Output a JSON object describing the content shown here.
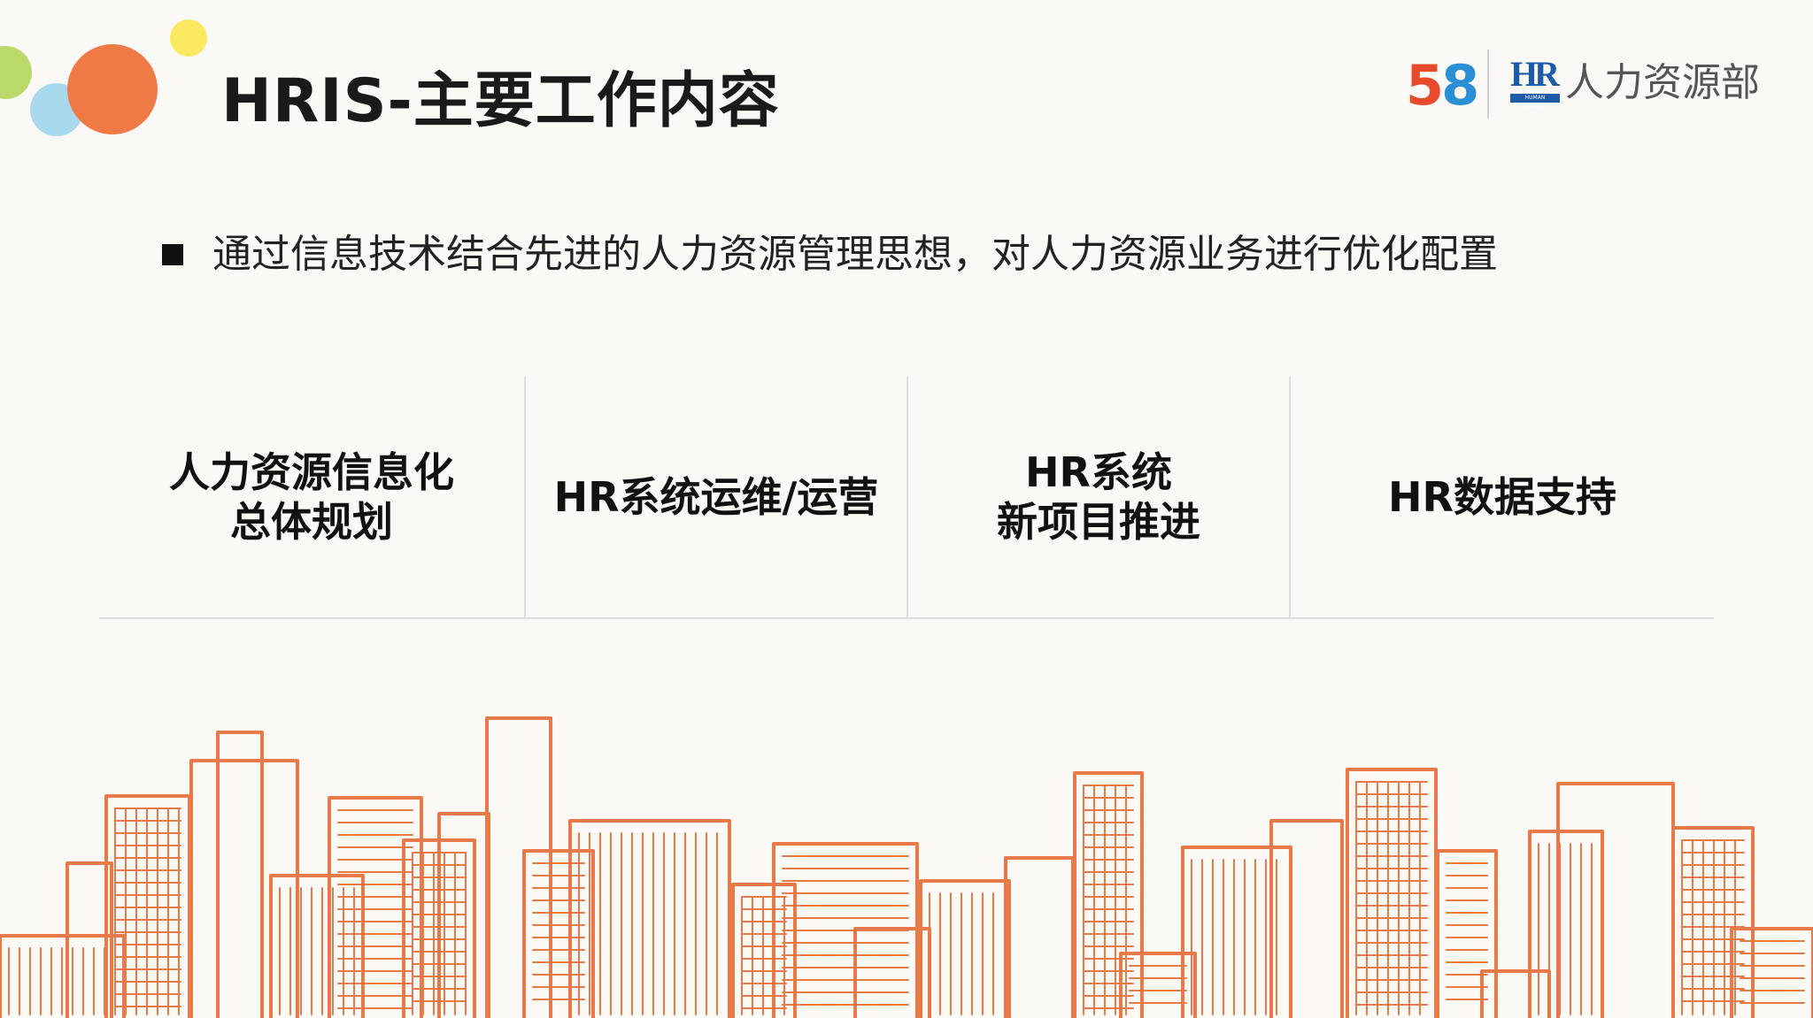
{
  "header": {
    "title": "HRIS-主要工作内容",
    "logo_58": {
      "digit1": "5",
      "digit2": "8"
    },
    "hr_badge": {
      "letters": "HR",
      "caption": "HUMAN RESOURCE"
    },
    "department": "人力资源部"
  },
  "bullet": {
    "text": "通过信息技术结合先进的人力资源管理思想，对人力资源业务进行优化配置"
  },
  "work_items": [
    {
      "line1": "人力资源信息化",
      "line2": "总体规划"
    },
    {
      "line1": "HR系统运维/运营",
      "line2": ""
    },
    {
      "line1": "HR系统",
      "line2": "新项目推进"
    },
    {
      "line1": "HR数据支持",
      "line2": ""
    }
  ],
  "colors": {
    "accent_orange": "#f07a45",
    "circle_green": "#b9d96a",
    "circle_blue": "#a9d9ec",
    "circle_yellow": "#fbe961",
    "skyline_stroke": "#e87a4a"
  }
}
